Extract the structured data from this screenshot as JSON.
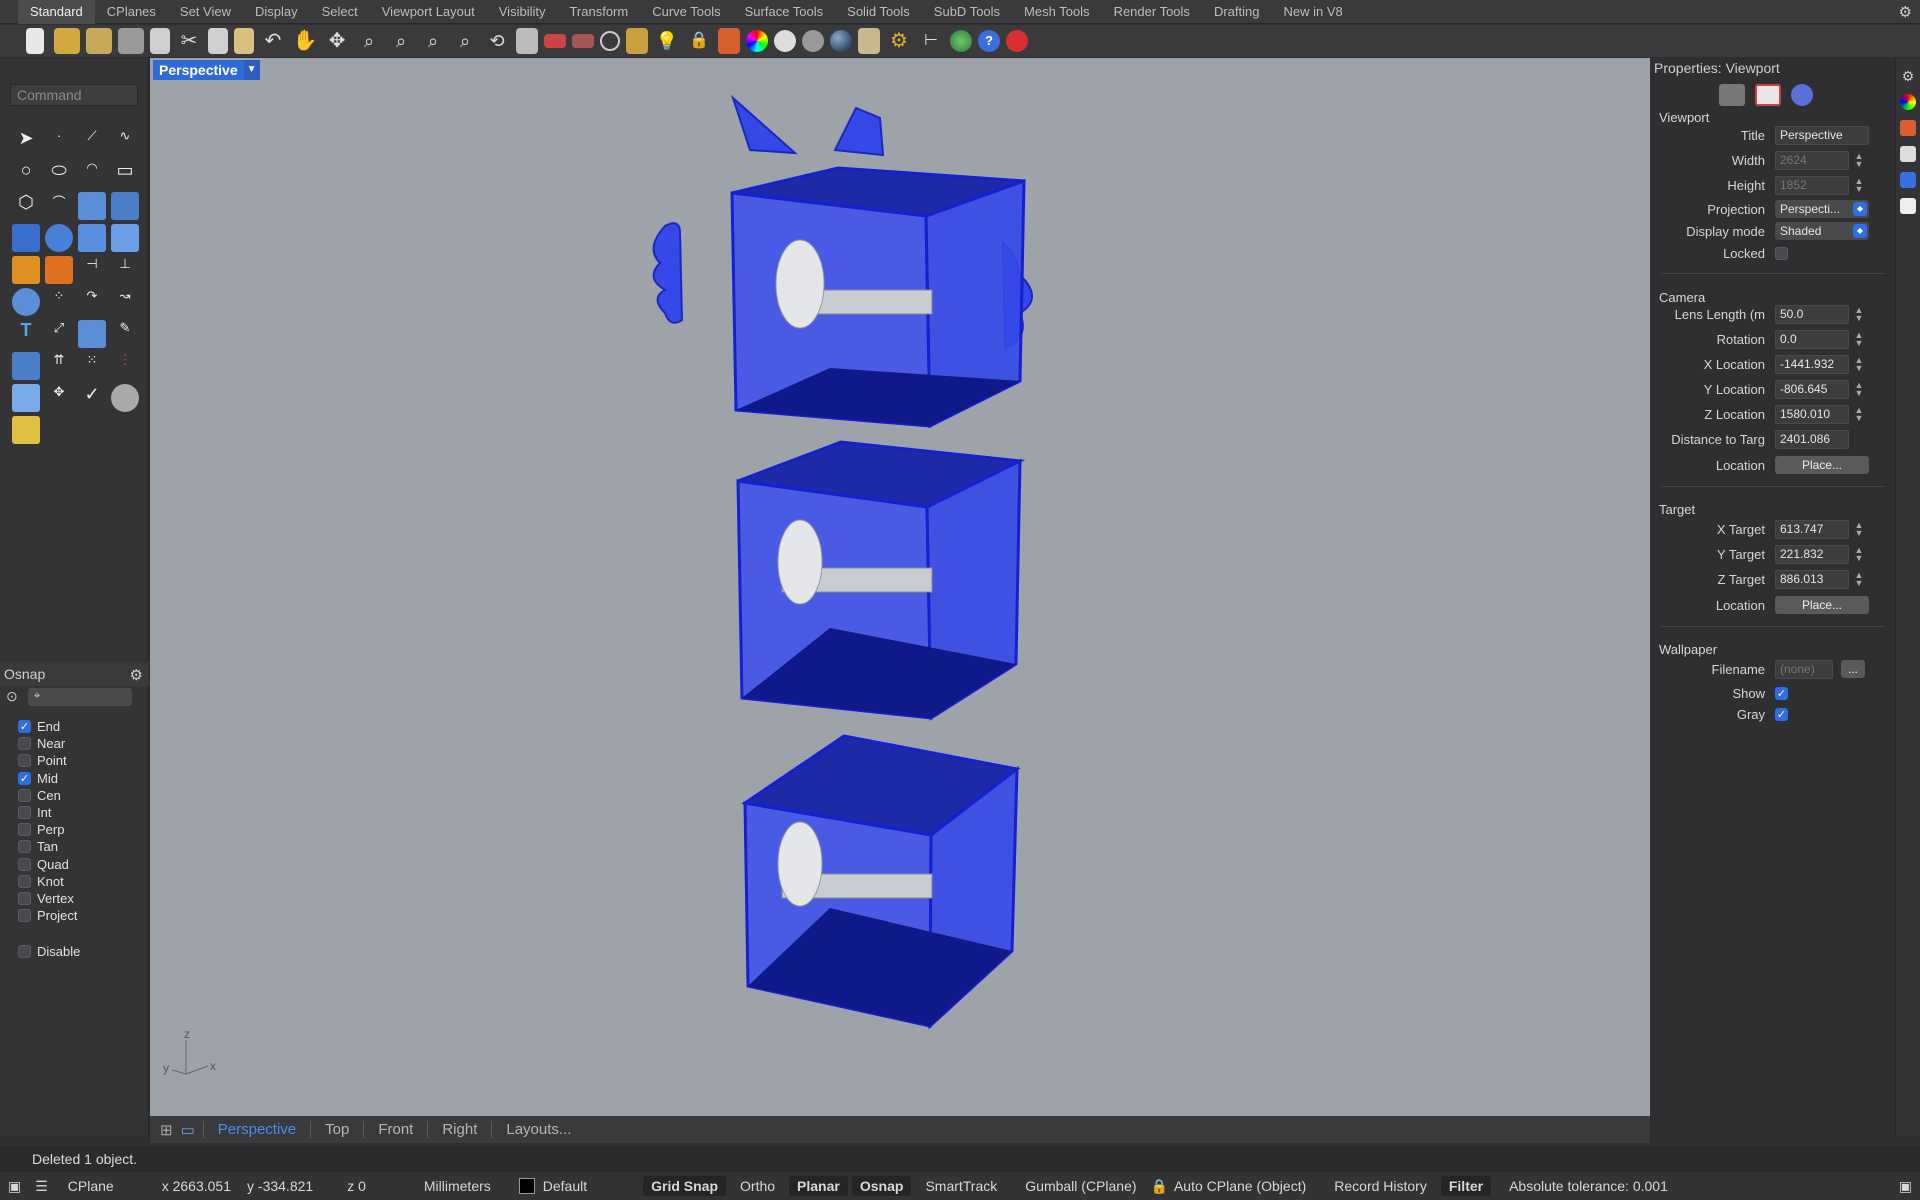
{
  "tabs": [
    "Standard",
    "CPlanes",
    "Set View",
    "Display",
    "Select",
    "Viewport Layout",
    "Visibility",
    "Transform",
    "Curve Tools",
    "Surface Tools",
    "Solid Tools",
    "SubD Tools",
    "Mesh Tools",
    "Render Tools",
    "Drafting",
    "New in V8"
  ],
  "command": {
    "placeholder": "Command"
  },
  "osnap": {
    "title": "Osnap",
    "items": [
      {
        "label": "End",
        "checked": true
      },
      {
        "label": "Near",
        "checked": false
      },
      {
        "label": "Point",
        "checked": false
      },
      {
        "label": "Mid",
        "checked": true
      },
      {
        "label": "Cen",
        "checked": false
      },
      {
        "label": "Int",
        "checked": false
      },
      {
        "label": "Perp",
        "checked": false
      },
      {
        "label": "Tan",
        "checked": false
      },
      {
        "label": "Quad",
        "checked": false
      },
      {
        "label": "Knot",
        "checked": false
      },
      {
        "label": "Vertex",
        "checked": false
      },
      {
        "label": "Project",
        "checked": false
      }
    ],
    "disable": "Disable"
  },
  "viewport": {
    "title": "Perspective",
    "axes": {
      "x": "x",
      "y": "y",
      "z": "z"
    }
  },
  "viewtabs": [
    "Perspective",
    "Top",
    "Front",
    "Right",
    "Layouts..."
  ],
  "props": {
    "title": "Properties: Viewport",
    "viewport": {
      "heading": "Viewport",
      "title_label": "Title",
      "title_value": "Perspective",
      "width_label": "Width",
      "width_value": "2624",
      "height_label": "Height",
      "height_value": "1852",
      "projection_label": "Projection",
      "projection_value": "Perspecti...",
      "display_label": "Display mode",
      "display_value": "Shaded",
      "locked_label": "Locked"
    },
    "camera": {
      "heading": "Camera",
      "lens_label": "Lens Length (m",
      "lens_value": "50.0",
      "rotation_label": "Rotation",
      "rotation_value": "0.0",
      "xloc_label": "X Location",
      "xloc_value": "-1441.932",
      "yloc_label": "Y Location",
      "yloc_value": "-806.645",
      "zloc_label": "Z Location",
      "zloc_value": "1580.010",
      "dist_label": "Distance to Targ",
      "dist_value": "2401.086",
      "location_label": "Location",
      "place": "Place..."
    },
    "target": {
      "heading": "Target",
      "x_label": "X Target",
      "x_value": "613.747",
      "y_label": "Y Target",
      "y_value": "221.832",
      "z_label": "Z Target",
      "z_value": "886.013",
      "location_label": "Location",
      "place": "Place..."
    },
    "wallpaper": {
      "heading": "Wallpaper",
      "filename_label": "Filename",
      "filename_value": "(none)",
      "browse": "...",
      "show_label": "Show",
      "gray_label": "Gray"
    }
  },
  "status": {
    "message": "Deleted 1 object.",
    "cplane": "CPlane",
    "x": "x 2663.051",
    "y": "y -334.821",
    "z": "z 0",
    "units": "Millimeters",
    "layer": "Default",
    "grid_snap": "Grid Snap",
    "ortho": "Ortho",
    "planar": "Planar",
    "osnap": "Osnap",
    "smarttrack": "SmartTrack",
    "gumball": "Gumball (CPlane)",
    "autocplane": "Auto CPlane (Object)",
    "record": "Record History",
    "filter": "Filter",
    "tolerance": "Absolute tolerance: 0.001"
  },
  "colors": {
    "accent": "#2f6ee0",
    "model_blue": "#2b3ff0"
  }
}
